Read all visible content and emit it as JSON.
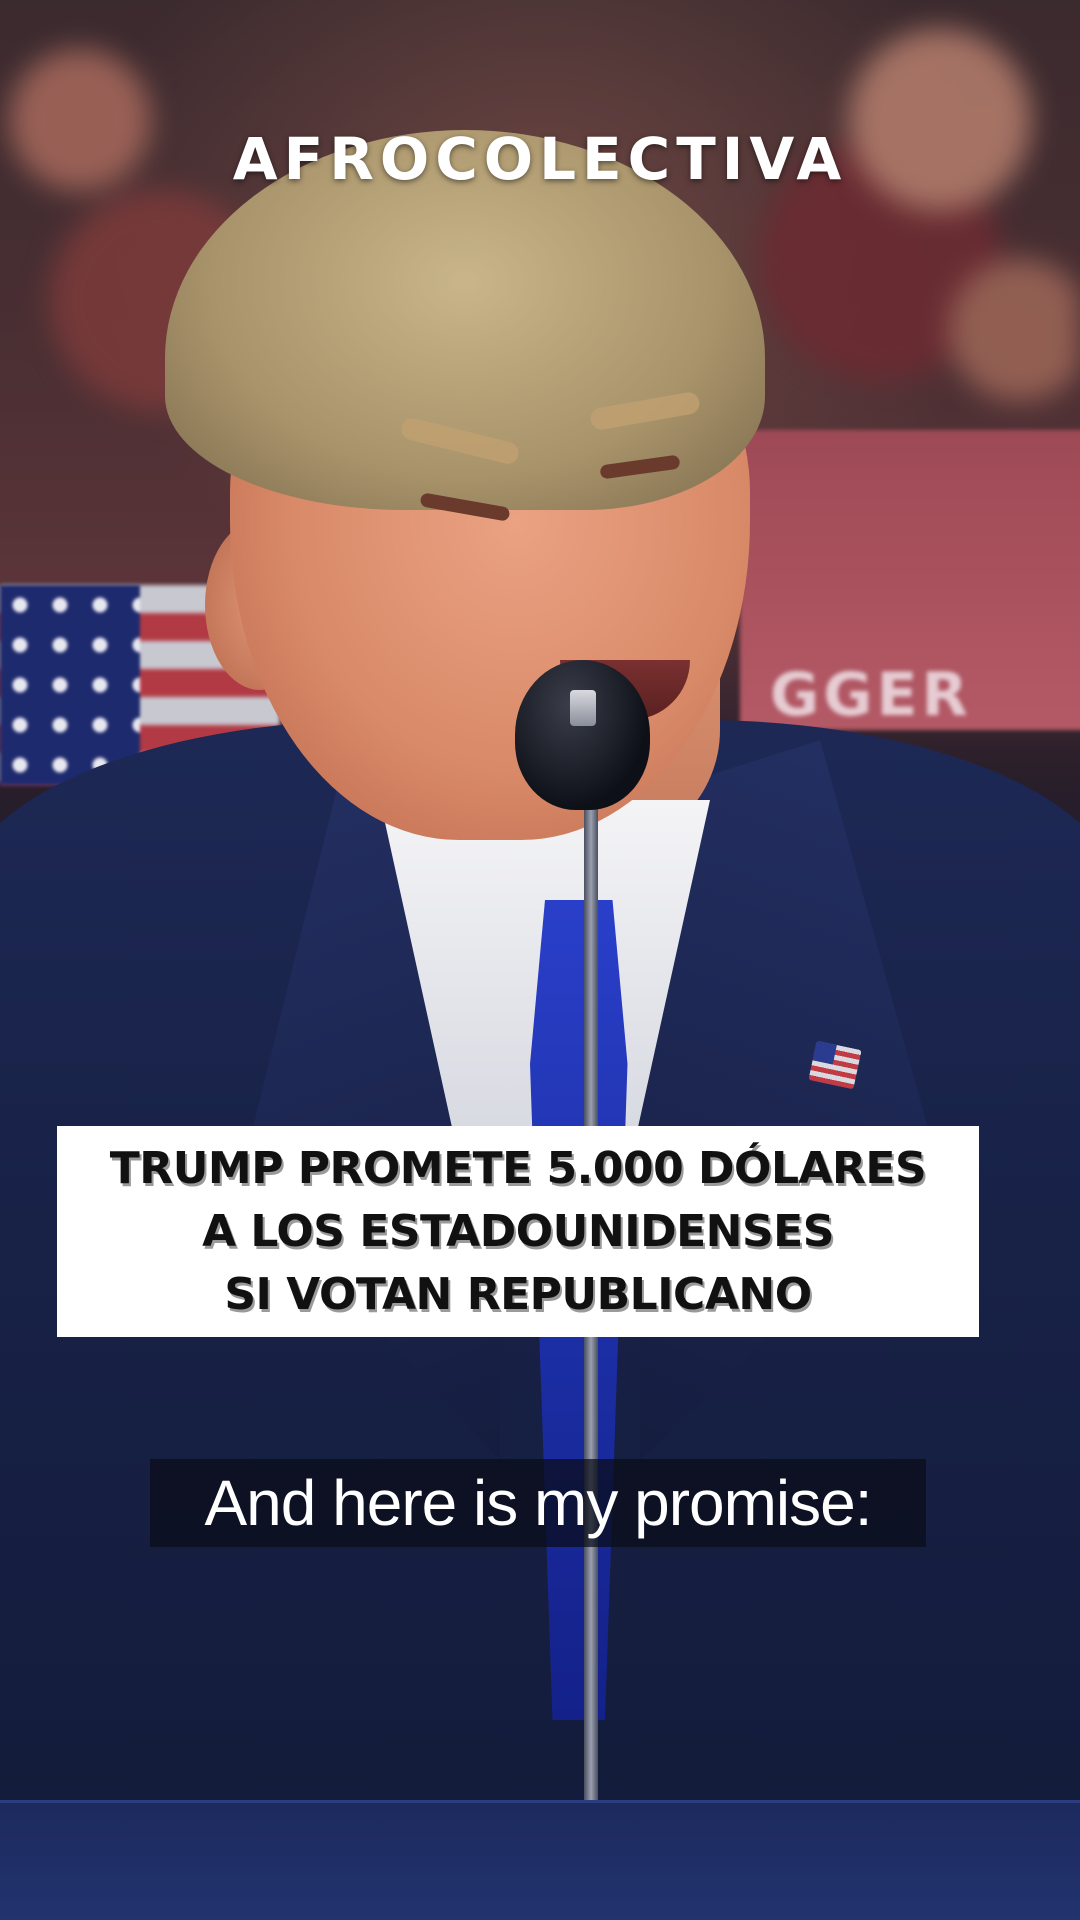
{
  "brand": {
    "logo_text": "AFROCOLECTIVA"
  },
  "headline": {
    "lines": [
      "TRUMP PROMETE 5.000 DÓLARES",
      "A LOS ESTADOUNIDENSES",
      "SI VOTAN REPUBLICANO"
    ]
  },
  "caption": {
    "text": "And here is my promise:"
  },
  "background": {
    "banner_text": "GGER"
  },
  "colors": {
    "headline_box": "#ffffff",
    "headline_text": "#111111",
    "caption_bg": "#0a0c18",
    "logo": "#ffffff"
  }
}
